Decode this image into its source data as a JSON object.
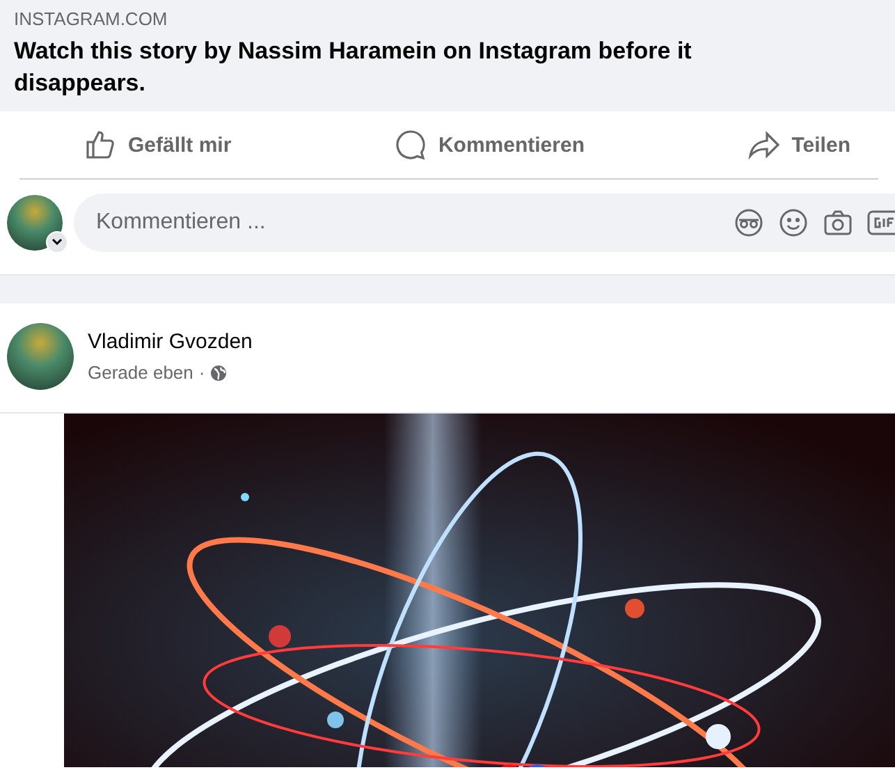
{
  "link_preview": {
    "domain": "INSTAGRAM.COM",
    "title": "Watch this story by Nassim Haramein on Instagram before it disappears."
  },
  "actions": [
    {
      "kind": "like",
      "label": "Gefällt mir"
    },
    {
      "kind": "comment",
      "label": "Kommentieren"
    },
    {
      "kind": "share",
      "label": "Teilen"
    }
  ],
  "comment_field": {
    "placeholder": "Kommentieren ..."
  },
  "post": {
    "author": "Vladimir Gvozden",
    "time": "Gerade eben",
    "separator": "·"
  }
}
